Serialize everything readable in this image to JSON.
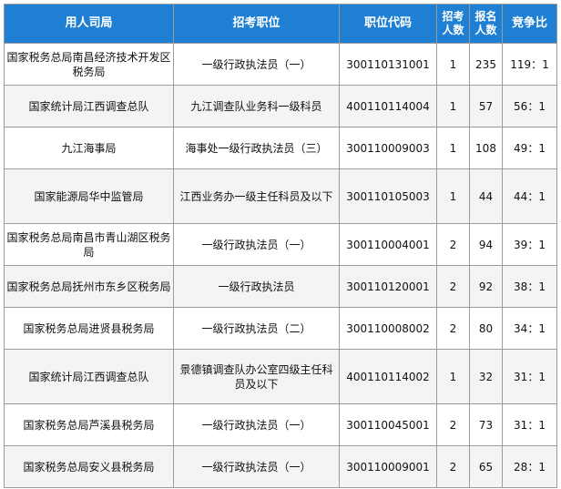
{
  "headers": {
    "org": "用人司局",
    "post": "招考职位",
    "code": "职位代码",
    "quota": "招考人数",
    "applicants": "报名人数",
    "ratio": "竞争比"
  },
  "rows": [
    {
      "org": "国家税务总局南昌经济技术开发区税务局",
      "post": "一级行政执法员（一）",
      "code": "300110131001",
      "quota": "1",
      "applicants": "235",
      "ratio": "119：1"
    },
    {
      "org": "国家统计局江西调查总队",
      "post": "九江调查队业务科一级科员",
      "code": "400110114004",
      "quota": "1",
      "applicants": "57",
      "ratio": "56：1"
    },
    {
      "org": "九江海事局",
      "post": "海事处一级行政执法员（三）",
      "code": "300110009003",
      "quota": "1",
      "applicants": "108",
      "ratio": "49：1"
    },
    {
      "org": "国家能源局华中监管局",
      "post": "江西业务办一级主任科员及以下",
      "code": "300110105003",
      "quota": "1",
      "applicants": "44",
      "ratio": "44：1"
    },
    {
      "org": "国家税务总局南昌市青山湖区税务局",
      "post": "一级行政执法员（一）",
      "code": "300110004001",
      "quota": "2",
      "applicants": "94",
      "ratio": "39：1"
    },
    {
      "org": "国家税务总局抚州市东乡区税务局",
      "post": "一级行政执法员",
      "code": "300110120001",
      "quota": "2",
      "applicants": "92",
      "ratio": "38：1"
    },
    {
      "org": "国家税务总局进贤县税务局",
      "post": "一级行政执法员（二）",
      "code": "300110008002",
      "quota": "2",
      "applicants": "80",
      "ratio": "34：1"
    },
    {
      "org": "国家统计局江西调查总队",
      "post": "景德镇调查队办公室四级主任科员及以下",
      "code": "400110114002",
      "quota": "1",
      "applicants": "32",
      "ratio": "31：1"
    },
    {
      "org": "国家税务总局芦溪县税务局",
      "post": "一级行政执法员（一）",
      "code": "300110045001",
      "quota": "2",
      "applicants": "73",
      "ratio": "31：1"
    },
    {
      "org": "国家税务总局安义县税务局",
      "post": "一级行政执法员（一）",
      "code": "300110009001",
      "quota": "2",
      "applicants": "65",
      "ratio": "28：1"
    }
  ]
}
